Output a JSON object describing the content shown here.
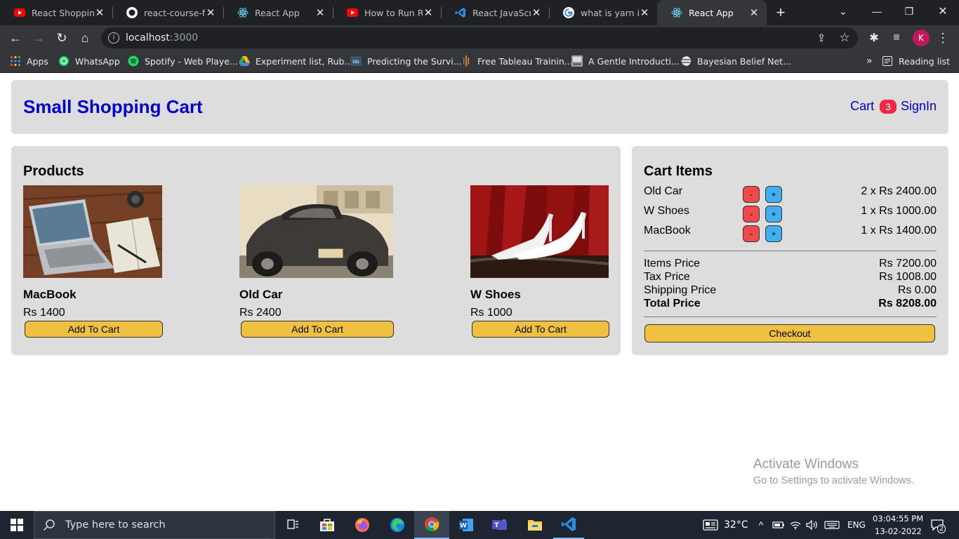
{
  "browser": {
    "tabs": [
      {
        "title": "React Shopping",
        "icon": "youtube-icon",
        "color": "#ff0000"
      },
      {
        "title": "react-course-fin",
        "icon": "github-icon",
        "color": "#ffffff"
      },
      {
        "title": "React App",
        "icon": "react-icon",
        "color": "#61dafb"
      },
      {
        "title": "How to Run Rea",
        "icon": "youtube-icon",
        "color": "#ff0000"
      },
      {
        "title": "React JavaScript",
        "icon": "vscode-icon",
        "color": "#2b8ce6"
      },
      {
        "title": "what is yarn in r",
        "icon": "google-icon",
        "color": "#4285f4"
      },
      {
        "title": "React App",
        "icon": "react-icon",
        "color": "#61dafb"
      }
    ],
    "active_tab_index": 6,
    "url_host": "localhost",
    "url_port": ":3000",
    "profile_initial": "K",
    "bookmarks": [
      {
        "label": "Apps",
        "icon": "apps-grid-icon"
      },
      {
        "label": "WhatsApp",
        "icon": "whatsapp-icon"
      },
      {
        "label": "Spotify - Web Playe...",
        "icon": "spotify-icon"
      },
      {
        "label": "Experiment list, Rub...",
        "icon": "google-drive-icon"
      },
      {
        "label": "Predicting the Survi...",
        "icon": "tds-icon"
      },
      {
        "label": "Free Tableau Trainin...",
        "icon": "tableau-icon"
      },
      {
        "label": "A Gentle Introducti...",
        "icon": "page-thumbnail-icon"
      },
      {
        "label": "Bayesian Belief Net...",
        "icon": "globe-icon"
      }
    ],
    "more_bookmarks": "»",
    "reading_list": "Reading list"
  },
  "app": {
    "brand": "Small Shopping Cart",
    "nav_cart": "Cart",
    "cart_count": "3",
    "nav_signin": "SignIn",
    "products_title": "Products",
    "products": [
      {
        "name": "MacBook",
        "price": "Rs 1400",
        "button": "Add To Cart",
        "image": "laptop-photo"
      },
      {
        "name": "Old Car",
        "price": "Rs 2400",
        "button": "Add To Cart",
        "image": "old-car-photo"
      },
      {
        "name": "W Shoes",
        "price": "Rs 1000",
        "button": "Add To Cart",
        "image": "white-heels-photo"
      }
    ],
    "cart_title": "Cart Items",
    "cart_items": [
      {
        "name": "Old Car",
        "minus": "-",
        "plus": "+",
        "qty_price": "2 x Rs 2400.00"
      },
      {
        "name": "W Shoes",
        "minus": "-",
        "plus": "+",
        "qty_price": "1 x Rs 1000.00"
      },
      {
        "name": "MacBook",
        "minus": "-",
        "plus": "+",
        "qty_price": "1 x Rs 1400.00"
      }
    ],
    "summary": {
      "items_label": "Items Price",
      "items_value": "Rs 7200.00",
      "tax_label": "Tax Price",
      "tax_value": "Rs 1008.00",
      "shipping_label": "Shipping Price",
      "shipping_value": "Rs 0.00",
      "total_label": "Total Price",
      "total_value": "Rs 8208.00"
    },
    "checkout": "Checkout",
    "colors": {
      "brand": "#0000cc",
      "button": "#f0c040",
      "minus": "#f04a4a",
      "plus": "#40b0f0",
      "badge": "#f02849",
      "panel": "#dddddd"
    }
  },
  "watermark": {
    "line1": "Activate Windows",
    "line2": "Go to Settings to activate Windows."
  },
  "taskbar": {
    "search_placeholder": "Type here to search",
    "temperature": "32°C",
    "language": "ENG",
    "time": "03:04:55 PM",
    "date": "13-02-2022",
    "notification_count": "2",
    "apps": [
      "task-view-icon",
      "store-icon",
      "firefox-icon",
      "edge-icon",
      "chrome-icon",
      "word-icon",
      "teams-icon",
      "file-explorer-icon",
      "vscode-icon"
    ]
  }
}
